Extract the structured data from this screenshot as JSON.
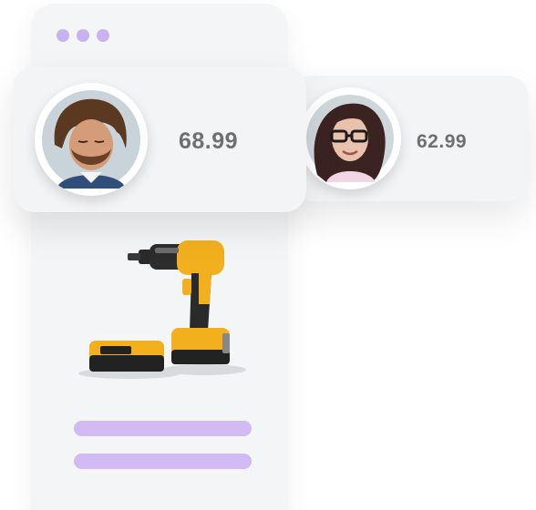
{
  "product_card": {
    "window_dots_icon": "three-dot-menu-icon",
    "product_image_icon": "cordless-drill-icon",
    "accent_color": "#d2baf5"
  },
  "bids": [
    {
      "amount": "68.99",
      "avatar_icon": "man-avatar-icon"
    },
    {
      "amount": "62.99",
      "avatar_icon": "woman-avatar-icon"
    }
  ]
}
